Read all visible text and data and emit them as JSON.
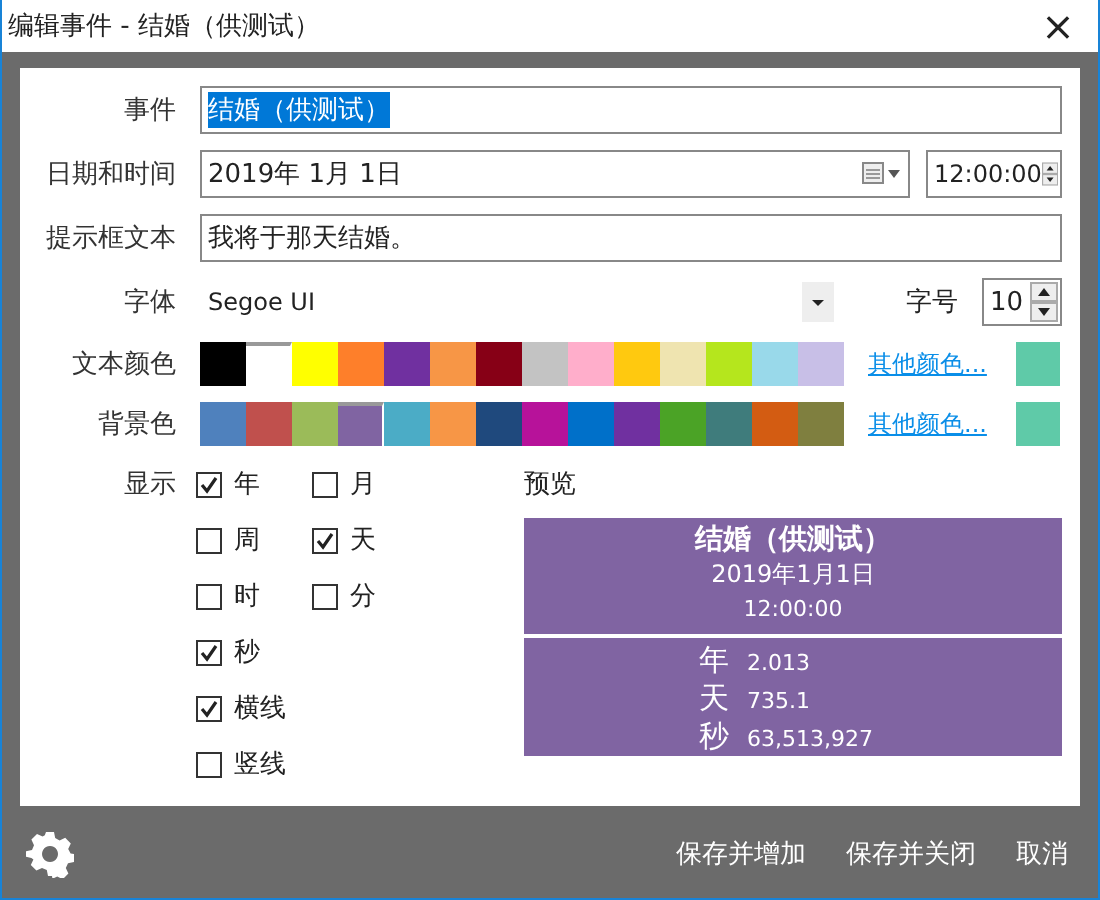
{
  "window": {
    "title": "编辑事件 - 结婚（供测试）",
    "close": "×"
  },
  "event": {
    "label": "事件",
    "value": "结婚（供测试）"
  },
  "datetime": {
    "label": "日期和时间",
    "date": "2019年  1月  1日",
    "time": "12:00:00"
  },
  "tooltip": {
    "label": "提示框文本",
    "value": "我将于那天结婚。"
  },
  "font": {
    "label": "字体",
    "value": "Segoe UI",
    "size_label": "字号",
    "size": "10"
  },
  "text_color": {
    "label": "文本颜色",
    "more": "其他颜色...",
    "swatches": [
      {
        "color": "#000000",
        "selected": false
      },
      {
        "color": "#ffffff",
        "selected": true
      },
      {
        "color": "#ffff00",
        "selected": false
      },
      {
        "color": "#fe7f2a",
        "selected": false
      },
      {
        "color": "#7030a0",
        "selected": false
      },
      {
        "color": "#f79646",
        "selected": false
      },
      {
        "color": "#870016",
        "selected": false
      },
      {
        "color": "#c3c3c3",
        "selected": false
      },
      {
        "color": "#ffaecb",
        "selected": false
      },
      {
        "color": "#ffc90f",
        "selected": false
      },
      {
        "color": "#efe4b0",
        "selected": false
      },
      {
        "color": "#b5e61d",
        "selected": false
      },
      {
        "color": "#99d9ea",
        "selected": false
      },
      {
        "color": "#c8bfe7",
        "selected": false
      }
    ]
  },
  "background_color": {
    "label": "背景色",
    "more": "其他颜色...",
    "swatches": [
      {
        "color": "#4f81bd",
        "selected": false
      },
      {
        "color": "#c0504d",
        "selected": false
      },
      {
        "color": "#9bbb59",
        "selected": false
      },
      {
        "color": "#8064a2",
        "selected": true
      },
      {
        "color": "#4bacc6",
        "selected": false
      },
      {
        "color": "#f79646",
        "selected": false
      },
      {
        "color": "#1f497d",
        "selected": false
      },
      {
        "color": "#b7129a",
        "selected": false
      },
      {
        "color": "#0070c9",
        "selected": false
      },
      {
        "color": "#7030a0",
        "selected": false
      },
      {
        "color": "#4ba326",
        "selected": false
      },
      {
        "color": "#3f7c7c",
        "selected": false
      },
      {
        "color": "#d35c12",
        "selected": false
      },
      {
        "color": "#7f7f3f",
        "selected": false
      }
    ]
  },
  "display": {
    "label": "显示",
    "rows": [
      [
        {
          "label": "年",
          "checked": true
        },
        {
          "label": "月",
          "checked": false
        }
      ],
      [
        {
          "label": "周",
          "checked": false
        },
        {
          "label": "天",
          "checked": true
        }
      ],
      [
        {
          "label": "时",
          "checked": false
        },
        {
          "label": "分",
          "checked": false
        }
      ],
      [
        {
          "label": "秒",
          "checked": true
        }
      ],
      [
        {
          "label": "横线",
          "checked": true
        }
      ],
      [
        {
          "label": "竖线",
          "checked": false
        }
      ]
    ]
  },
  "preview": {
    "label": "预览",
    "title": "结婚（供测试）",
    "date": "2019年1月1日",
    "time": "12:00:00",
    "rows": [
      {
        "unit": "年",
        "value": "2.013"
      },
      {
        "unit": "天",
        "value": "735.1"
      },
      {
        "unit": "秒",
        "value": "63,513,927"
      }
    ]
  },
  "buttons": [
    "保存并增加",
    "保存并关闭",
    "取消"
  ]
}
